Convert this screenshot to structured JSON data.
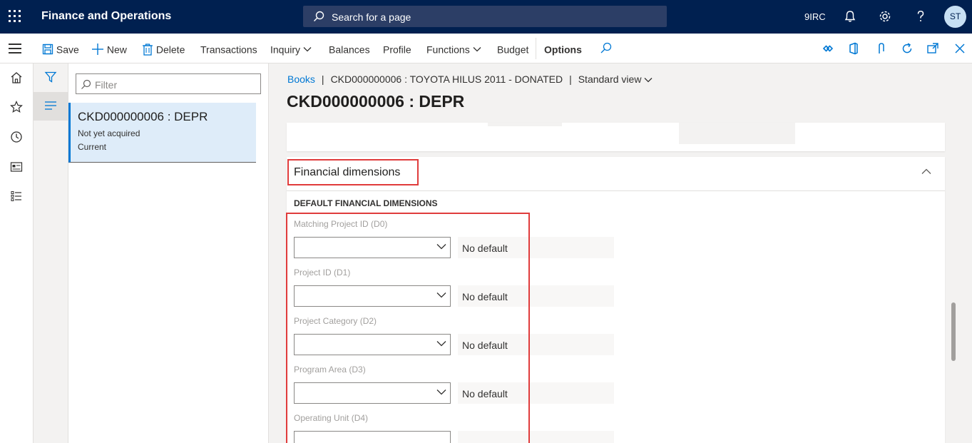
{
  "app": {
    "title": "Finance and Operations",
    "search_placeholder": "Search for a page",
    "company": "9IRC",
    "user_initials": "ST"
  },
  "actions": {
    "save": "Save",
    "new": "New",
    "delete": "Delete",
    "transactions": "Transactions",
    "inquiry": "Inquiry",
    "balances": "Balances",
    "profile": "Profile",
    "functions": "Functions",
    "budget": "Budget",
    "options": "Options",
    "attachments_count": "0"
  },
  "list": {
    "filter_placeholder": "Filter",
    "items": [
      {
        "title": "CKD000000006 : DEPR",
        "status": "Not yet acquired",
        "period": "Current"
      }
    ]
  },
  "breadcrumb": {
    "books": "Books",
    "record": "CKD000000006 : TOYOTA HILUS 2011 - DONATED",
    "view": "Standard view"
  },
  "page": {
    "title": "CKD000000006 : DEPR"
  },
  "financial_dimensions": {
    "section_title": "Financial dimensions",
    "group_title": "DEFAULT FINANCIAL DIMENSIONS",
    "dimensions": [
      {
        "label": "Matching Project ID (D0)",
        "value": "",
        "default_text": "No default"
      },
      {
        "label": "Project ID (D1)",
        "value": "",
        "default_text": "No default"
      },
      {
        "label": "Project Category (D2)",
        "value": "",
        "default_text": "No default"
      },
      {
        "label": "Program Area (D3)",
        "value": "",
        "default_text": "No default"
      },
      {
        "label": "Operating Unit (D4)",
        "value": "",
        "default_text": ""
      }
    ]
  },
  "colors": {
    "nav_bar": "#002050",
    "accent": "#0078d4",
    "highlight_box": "#e03c3c",
    "selected_item": "#deecf9"
  }
}
